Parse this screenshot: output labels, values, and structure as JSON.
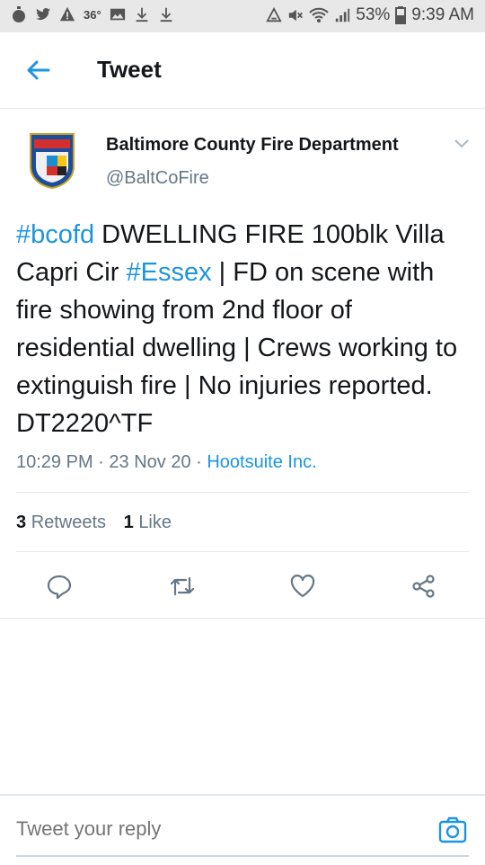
{
  "status_bar": {
    "left_icons": [
      "timer-icon",
      "twitter-bird-icon",
      "warning-icon",
      "temperature-icon",
      "image-icon",
      "download-icon",
      "download-icon"
    ],
    "temperature": "36°",
    "right_icons": [
      "data-saver-icon",
      "mute-icon",
      "wifi-icon",
      "signal-icon",
      "battery-icon"
    ],
    "battery": "53%",
    "time": "9:39 AM"
  },
  "app_bar": {
    "title": "Tweet",
    "back_icon": "arrow-left-icon"
  },
  "tweet": {
    "author_name": "Baltimore County Fire Department",
    "handle": "@BaltCoFire",
    "text": {
      "hashtag1": "#bcofd",
      "part1": " DWELLING FIRE 100blk Villa Capri Cir ",
      "hashtag2": "#Essex",
      "part2": " | FD on scene with fire showing from 2nd floor of residential dwelling | Crews working to extinguish fire | No injuries reported. DT2220^TF"
    },
    "time": "10:29 PM",
    "date": "23 Nov 20",
    "separator": " · ",
    "source": "Hootsuite Inc.",
    "retweet_count": "3",
    "retweet_label": "Retweets",
    "like_count": "1",
    "like_label": "Like"
  },
  "actions": [
    "reply-icon",
    "retweet-icon",
    "like-icon",
    "share-icon"
  ],
  "reply_bar": {
    "placeholder": "Tweet your reply",
    "camera_icon": "camera-icon"
  },
  "colors": {
    "accent": "#1b95e0",
    "text": "#14171a",
    "secondary": "#657786",
    "divider": "#e1e8ed",
    "status_bar_bg": "#e8e8e8"
  }
}
